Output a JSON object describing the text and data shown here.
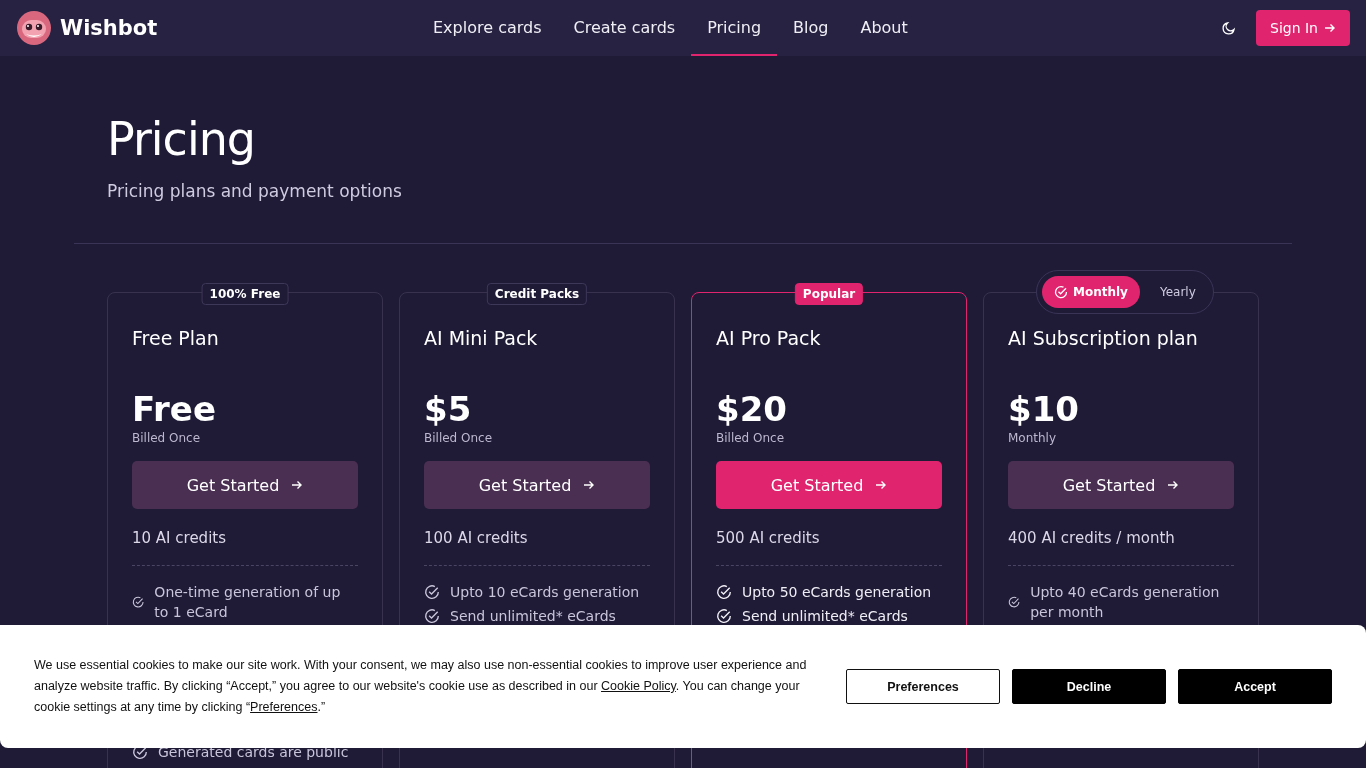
{
  "brand": {
    "name": "Wishbot"
  },
  "nav": [
    {
      "label": "Explore cards",
      "selected": false
    },
    {
      "label": "Create cards",
      "selected": false
    },
    {
      "label": "Pricing",
      "selected": true
    },
    {
      "label": "Blog",
      "selected": false
    },
    {
      "label": "About",
      "selected": false
    }
  ],
  "sign_in": "Sign In",
  "header": {
    "title": "Pricing",
    "subtitle": "Pricing plans and payment options"
  },
  "plans": [
    {
      "badge": "100% Free",
      "popular": false,
      "name": "Free Plan",
      "price": "Free",
      "billing": "Billed Once",
      "button": "Get Started",
      "credits": "10 AI credits",
      "features": [
        "One-time generation of up to 1 eCard"
      ],
      "lower_features": [
        "Generated cards are public"
      ]
    },
    {
      "badge": "Credit Packs",
      "popular": false,
      "name": "AI Mini Pack",
      "price": "$5",
      "billing": "Billed Once",
      "button": "Get Started",
      "credits": "100 AI credits",
      "features": [
        "Upto 10 eCards generation",
        "Send unlimited* eCards"
      ]
    },
    {
      "badge": "Popular",
      "popular": true,
      "name": "AI Pro Pack",
      "price": "$20",
      "billing": "Billed Once",
      "button": "Get Started",
      "credits": "500 AI credits",
      "features": [
        "Upto 50 eCards generation",
        "Send unlimited* eCards"
      ]
    },
    {
      "popular": false,
      "billing_toggle": [
        {
          "label": "Monthly",
          "selected": true
        },
        {
          "label": "Yearly",
          "selected": false
        }
      ],
      "name": "AI Subscription plan",
      "price": "$10",
      "billing": "Monthly",
      "button": "Get Started",
      "credits": "400 AI credits / month",
      "features": [
        "Upto 40 eCards generation per month"
      ]
    }
  ],
  "cookie_banner": {
    "text": "We use essential cookies to make our site work. With your consent, we may also use non-essential cookies to improve user experience and analyze website traffic. By clicking “Accept,” you agree to our website's cookie use as described in our ",
    "link": "Cookie Policy",
    "text_2": ". You can change your cookie settings at any time by clicking “",
    "link_2": "Preferences",
    "text_3": ".”",
    "buttons": [
      {
        "label": "Preferences",
        "kind": "outline"
      },
      {
        "label": "Decline",
        "kind": "solid"
      },
      {
        "label": "Accept",
        "kind": "solid"
      }
    ]
  }
}
